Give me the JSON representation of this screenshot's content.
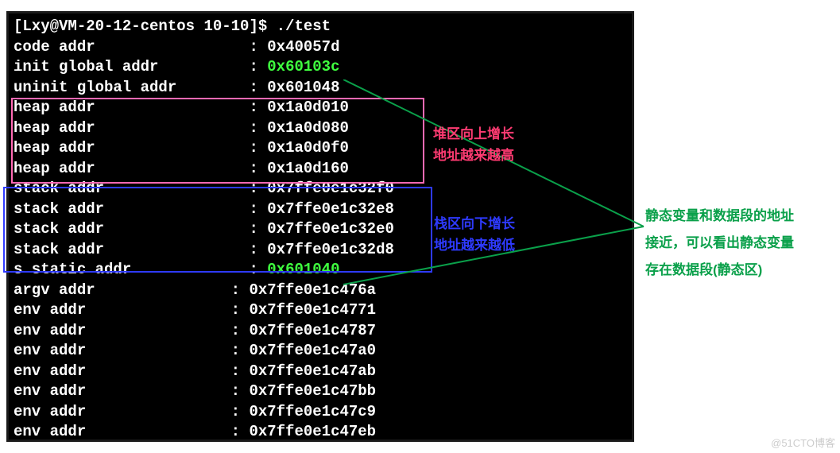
{
  "prompt": "[Lxy@VM-20-12-centos 10-10]$ ./test",
  "lines": [
    {
      "label": "code addr",
      "sep": ":",
      "value": "0x40057d",
      "labelPad": 26,
      "sepPad": 2
    },
    {
      "label": "init global addr",
      "sep": ":",
      "value": "0x60103c",
      "labelPad": 26,
      "sepPad": 2,
      "valueClass": "green"
    },
    {
      "label": "uninit global addr",
      "sep": ":",
      "value": "0x601048",
      "labelPad": 26,
      "sepPad": 2
    },
    {
      "label": "heap addr",
      "sep": ":",
      "value": "0x1a0d010",
      "labelPad": 26,
      "sepPad": 2
    },
    {
      "label": "heap addr",
      "sep": ":",
      "value": "0x1a0d080",
      "labelPad": 26,
      "sepPad": 2
    },
    {
      "label": "heap addr",
      "sep": ":",
      "value": "0x1a0d0f0",
      "labelPad": 26,
      "sepPad": 2
    },
    {
      "label": "heap addr",
      "sep": ":",
      "value": "0x1a0d160",
      "labelPad": 26,
      "sepPad": 2
    },
    {
      "label": "stack addr",
      "sep": ":",
      "value": "0x7ffe0e1c32f0",
      "labelPad": 26,
      "sepPad": 2
    },
    {
      "label": "stack addr",
      "sep": ":",
      "value": "0x7ffe0e1c32e8",
      "labelPad": 26,
      "sepPad": 2
    },
    {
      "label": "stack addr",
      "sep": ":",
      "value": "0x7ffe0e1c32e0",
      "labelPad": 26,
      "sepPad": 2
    },
    {
      "label": "stack addr",
      "sep": ":",
      "value": "0x7ffe0e1c32d8",
      "labelPad": 26,
      "sepPad": 2
    },
    {
      "label": "s static addr",
      "sep": ":",
      "value": "0x601040",
      "labelPad": 26,
      "sepPad": 2,
      "valueClass": "green"
    },
    {
      "label": "argv addr",
      "sep": ":",
      "value": "0x7ffe0e1c476a",
      "labelPad": 24,
      "sepPad": 2
    },
    {
      "label": "env addr",
      "sep": ":",
      "value": "0x7ffe0e1c4771",
      "labelPad": 24,
      "sepPad": 2
    },
    {
      "label": "env addr",
      "sep": ":",
      "value": "0x7ffe0e1c4787",
      "labelPad": 24,
      "sepPad": 2
    },
    {
      "label": "env addr",
      "sep": ":",
      "value": "0x7ffe0e1c47a0",
      "labelPad": 24,
      "sepPad": 2
    },
    {
      "label": "env addr",
      "sep": ":",
      "value": "0x7ffe0e1c47ab",
      "labelPad": 24,
      "sepPad": 2
    },
    {
      "label": "env addr",
      "sep": ":",
      "value": "0x7ffe0e1c47bb",
      "labelPad": 24,
      "sepPad": 2
    },
    {
      "label": "env addr",
      "sep": ":",
      "value": "0x7ffe0e1c47c9",
      "labelPad": 24,
      "sepPad": 2
    },
    {
      "label": "env addr",
      "sep": ":",
      "value": "0x7ffe0e1c47eb",
      "labelPad": 24,
      "sepPad": 2
    }
  ],
  "heapNote1": "堆区向上增长",
  "heapNote2": "地址越来越高",
  "stackNote1": "栈区向下增长",
  "stackNote2": "地址越来越低",
  "staticNote1": "静态变量和数据段的地址",
  "staticNote2": "接近，可以看出静态变量",
  "staticNote3": "存在数据段(静态区)",
  "watermark": "@51CTO博客"
}
